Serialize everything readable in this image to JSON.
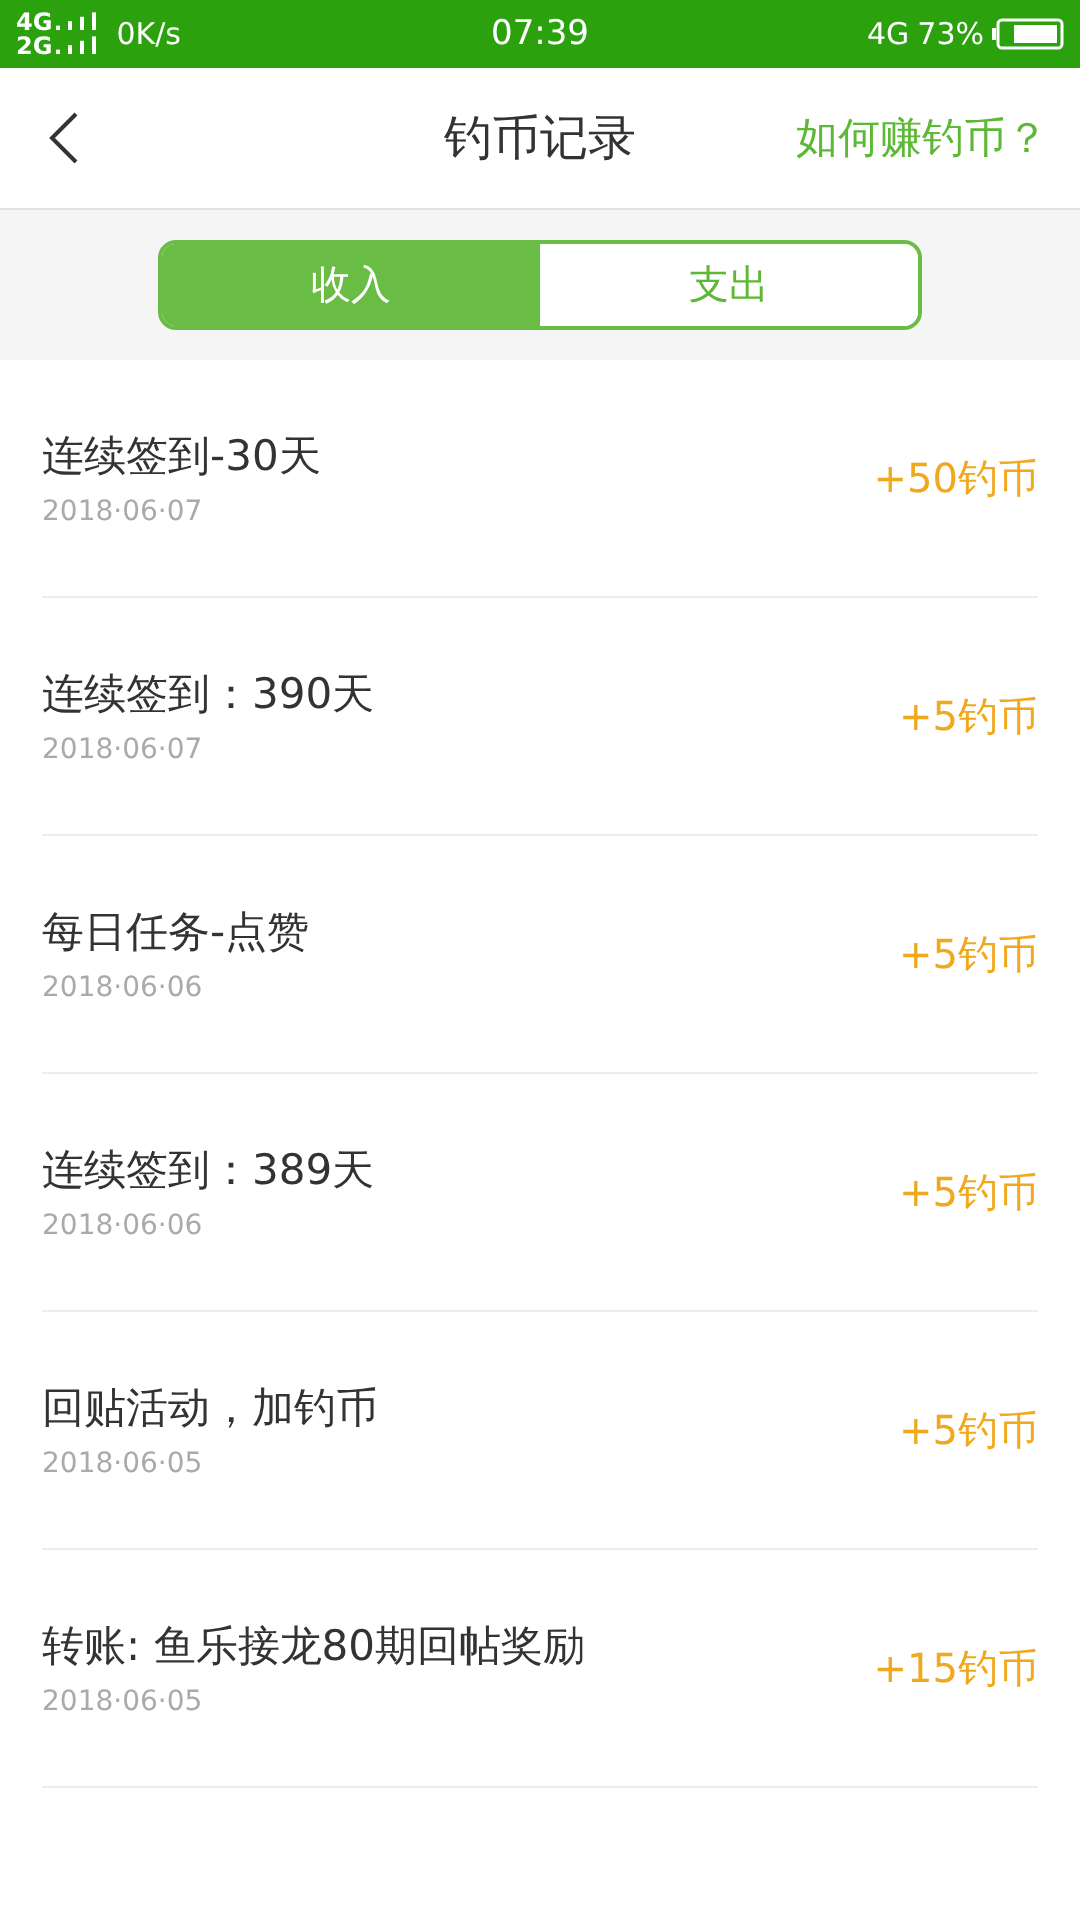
{
  "status_bar": {
    "network_top": "4G",
    "network_bottom": "2G",
    "speed": "0K/s",
    "time": "07:39",
    "network_right": "4G",
    "battery": "73%"
  },
  "header": {
    "title": "钓币记录",
    "link": "如何赚钓币？"
  },
  "tabs": [
    {
      "label": "收入",
      "selected": true
    },
    {
      "label": "支出",
      "selected": false
    }
  ],
  "records": [
    {
      "title": "连续签到-30天",
      "date": "2018·06·07",
      "amount": "+50钓币"
    },
    {
      "title": "连续签到：390天",
      "date": "2018·06·07",
      "amount": "+5钓币"
    },
    {
      "title": "每日任务-点赞",
      "date": "2018·06·06",
      "amount": "+5钓币"
    },
    {
      "title": "连续签到：389天",
      "date": "2018·06·06",
      "amount": "+5钓币"
    },
    {
      "title": "回贴活动，加钓币",
      "date": "2018·06·05",
      "amount": "+5钓币"
    },
    {
      "title": "转账: 鱼乐接龙80期回帖奖励",
      "date": "2018·06·05",
      "amount": "+15钓币"
    }
  ]
}
